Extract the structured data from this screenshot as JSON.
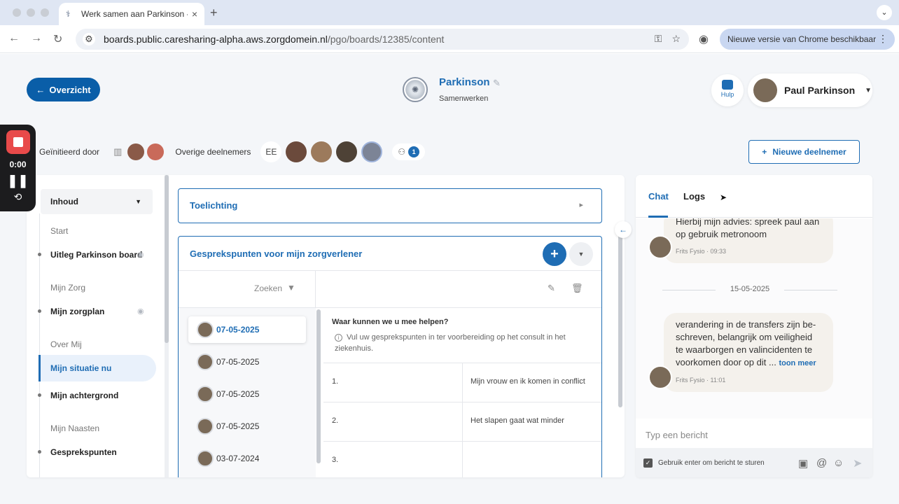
{
  "browser": {
    "tab_title": "Werk samen aan Parkinson -",
    "tab_close": "×",
    "new_tab": "+",
    "url_host": "boards.public.caresharing-alpha.aws.zorgdomein.nl",
    "url_path": "/pgo/boards/12385/content",
    "update_label": "Nieuwe versie van Chrome beschikbaar"
  },
  "header": {
    "back_label": "Overzicht",
    "board_title": "Parkinson",
    "board_subtitle": "Samenwerken",
    "help_label": "Hulp",
    "user_name": "Paul Parkinson"
  },
  "recorder": {
    "time": "0:00"
  },
  "participants": {
    "initiated_label": "Geïnitieerd door",
    "others_label": "Overige deelnemers",
    "initials": "EE",
    "count": "1",
    "new_member_label": "Nieuwe deelnemer"
  },
  "sidebar": {
    "dropdown": "Inhoud",
    "sections": [
      {
        "label": "Start",
        "items": [
          "Uitleg Parkinson board"
        ]
      },
      {
        "label": "Mijn Zorg",
        "items": [
          "Mijn zorgplan"
        ]
      },
      {
        "label": "Over Mij",
        "items": [
          "Mijn situatie nu",
          "Mijn achtergrond"
        ]
      },
      {
        "label": "Mijn Naasten",
        "items": [
          "Gesprekspunten"
        ]
      }
    ]
  },
  "main": {
    "toelichting_title": "Toelichting",
    "section_title": "Gesprekspunten voor mijn zorgverlener",
    "search_label": "Zoeken",
    "dates": [
      "07-05-2025",
      "07-05-2025",
      "07-05-2025",
      "07-05-2025",
      "03-07-2024"
    ],
    "question_title": "Waar kunnen we u mee helpen?",
    "question_info": "Vul uw gesprekspunten in ter voorbereiding op het consult in het ziekenhuis.",
    "rows": [
      {
        "num": "1.",
        "text": "Mijn vrouw en ik komen in conflict"
      },
      {
        "num": "2.",
        "text": "Het slapen gaat wat minder"
      },
      {
        "num": "3.",
        "text": ""
      }
    ]
  },
  "chat": {
    "tab_chat": "Chat",
    "tab_logs": "Logs",
    "msg1_text": "Hierbij mijn advies: spreek paul aan op gebruik metronoom",
    "msg1_meta": "Frits Fysio · 09:33",
    "date_separator": "15-05-2025",
    "msg2_text": "verandering in de transfers zijn be-schreven, belangrijk om veiligheid te waarborgen en valincidenten te voorkomen door op dit ...",
    "msg2_more": "toon meer",
    "msg2_meta": "Frits Fysio · 11:01",
    "input_placeholder": "Typ een bericht",
    "enter_label": "Gebruik enter om bericht te sturen"
  },
  "colors": {
    "primary": "#1f6db4",
    "back_button": "#0a5ea8",
    "record": "#e84a4a"
  }
}
